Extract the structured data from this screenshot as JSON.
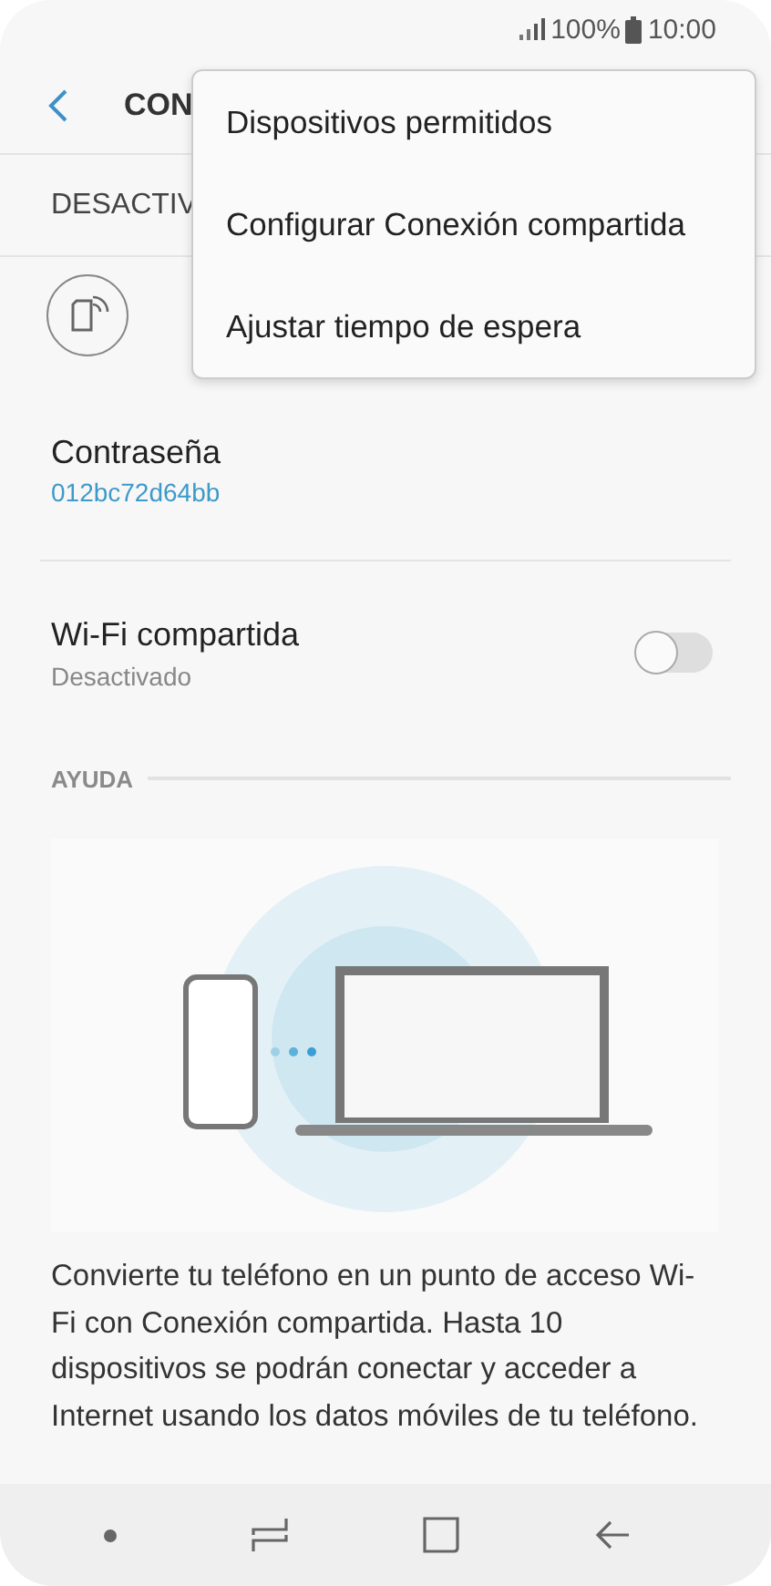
{
  "status_bar": {
    "battery": "100%",
    "time": "10:00"
  },
  "header": {
    "title": "CON"
  },
  "master_switch": {
    "label": "DESACTIV"
  },
  "settings": [
    {
      "kind": "value",
      "title": "Contraseña",
      "value": "012bc72d64bb"
    },
    {
      "kind": "toggle",
      "title": "Wi-Fi compartida",
      "subtitle": "Desactivado",
      "on": false
    }
  ],
  "help": {
    "heading": "AYUDA",
    "text": "Convierte tu teléfono en un punto de acceso Wi-Fi con Conexión compartida. Hasta 10 dispositivos se podrán conectar y acceder a Internet usando los datos móviles de tu teléfono."
  },
  "menu": {
    "items": [
      "Dispositivos permitidos",
      "Configurar Conexión compartida",
      "Ajustar tiempo de espera"
    ]
  }
}
